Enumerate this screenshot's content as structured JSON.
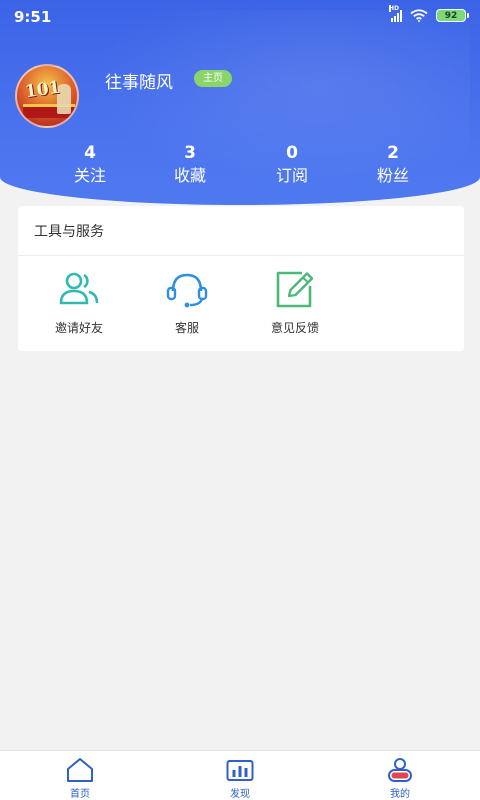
{
  "status_bar": {
    "time": "9:51",
    "hd_label": "HD",
    "battery": "92"
  },
  "profile": {
    "username": "往事随风",
    "home_badge": "主页",
    "avatar_text": "101"
  },
  "stats": [
    {
      "value": "4",
      "label": "关注"
    },
    {
      "value": "3",
      "label": "收藏"
    },
    {
      "value": "0",
      "label": "订阅"
    },
    {
      "value": "2",
      "label": "粉丝"
    }
  ],
  "tools": {
    "title": "工具与服务",
    "items": [
      {
        "label": "邀请好友",
        "icon": "invite-friends-icon"
      },
      {
        "label": "客服",
        "icon": "headset-icon"
      },
      {
        "label": "意见反馈",
        "icon": "feedback-edit-icon"
      }
    ]
  },
  "tabbar": {
    "items": [
      {
        "label": "首页",
        "icon": "home-icon"
      },
      {
        "label": "发现",
        "icon": "discover-chart-icon"
      },
      {
        "label": "我的",
        "icon": "profile-icon"
      }
    ]
  },
  "colors": {
    "header_blue": "#4a72ee",
    "badge_green": "#8bd46a",
    "tool_teal": "#2fb9b0",
    "tool_blue": "#2f8fe0",
    "tool_green": "#4cb87a",
    "tab_blue": "#2f5fc9",
    "tab_red": "#e0474c"
  }
}
